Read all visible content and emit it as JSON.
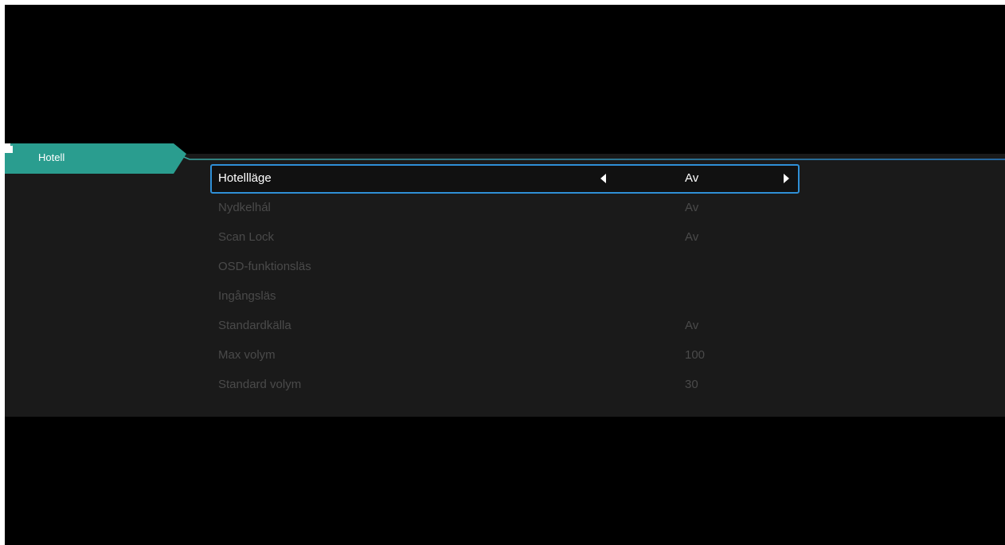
{
  "colors": {
    "background": "#000000",
    "panel": "#1a1a1a",
    "tab_accent": "#2a9d8f",
    "selection_border": "#2f8fd6",
    "selected_text": "#ffffff",
    "dim_text": "#4a4a4a"
  },
  "tab": {
    "label": "Hotell",
    "icon": "document-icon"
  },
  "menu": {
    "items": [
      {
        "label": "Hotellläge",
        "value": "Av",
        "selected": true
      },
      {
        "label": "Nydkelhál",
        "value": "Av",
        "selected": false
      },
      {
        "label": "Scan Lock",
        "value": "Av",
        "selected": false
      },
      {
        "label": "OSD-funktionsläs",
        "value": "",
        "selected": false
      },
      {
        "label": "Ingångsläs",
        "value": "",
        "selected": false
      },
      {
        "label": "Standardkälla",
        "value": "Av",
        "selected": false
      },
      {
        "label": "Max volym",
        "value": "100",
        "selected": false
      },
      {
        "label": "Standard volym",
        "value": "30",
        "selected": false
      }
    ]
  }
}
